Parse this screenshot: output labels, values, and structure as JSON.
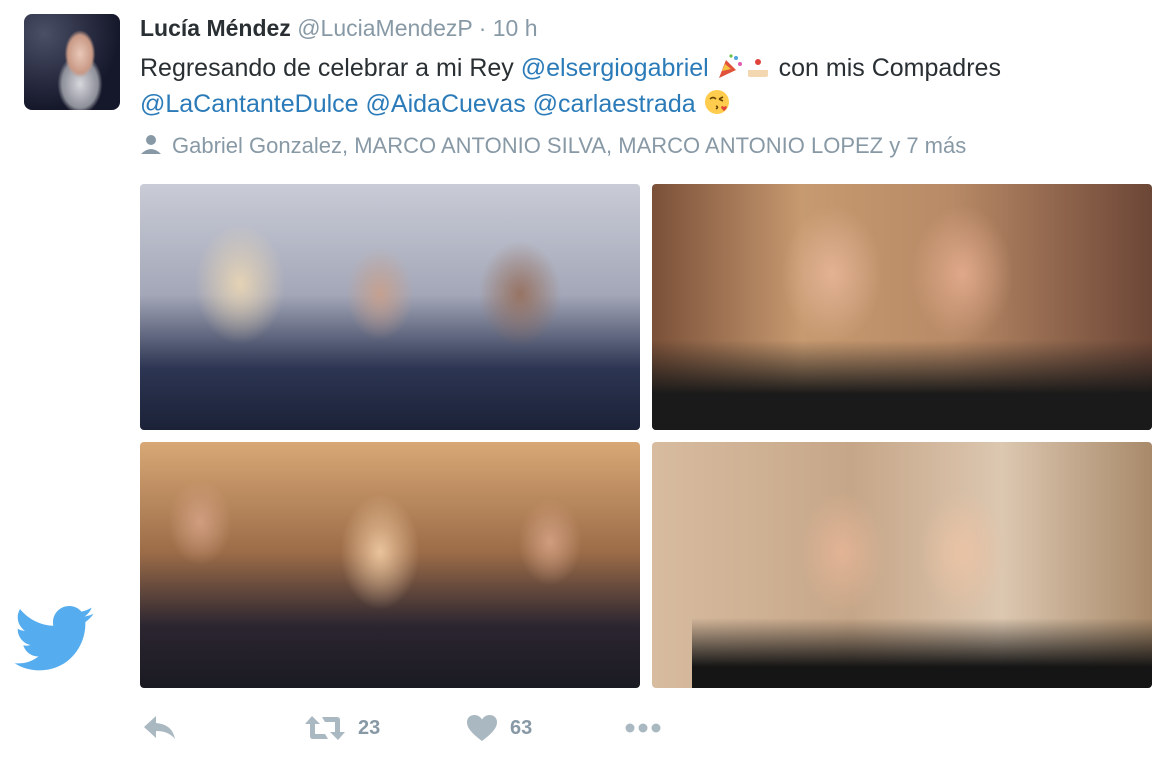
{
  "tweet": {
    "name": "Lucía Méndez",
    "handle": "@LuciaMendezP",
    "separator": "·",
    "time": "10 h",
    "text_part1": "Regresando de celebrar a mi Rey ",
    "mention1": "@elsergiogabriel",
    "text_part2": " con mis Compadres",
    "mention2": "@LaCantanteDulce",
    "mention3": "@AidaCuevas",
    "mention4": "@carlaestrada",
    "emojis": [
      "party-popper-emoji",
      "cake-emoji",
      "kiss-face-emoji"
    ],
    "tagged": "Gabriel Gonzalez, MARCO ANTONIO SILVA, MARCO ANTONIO LOPEZ y 7 más"
  },
  "actions": {
    "retweets": "23",
    "likes": "63"
  },
  "colors": {
    "link": "#2b7bb9",
    "muted": "#8899a6",
    "text": "#292f33",
    "twitter_blue": "#55acee",
    "action_icon": "#aab8c2"
  }
}
